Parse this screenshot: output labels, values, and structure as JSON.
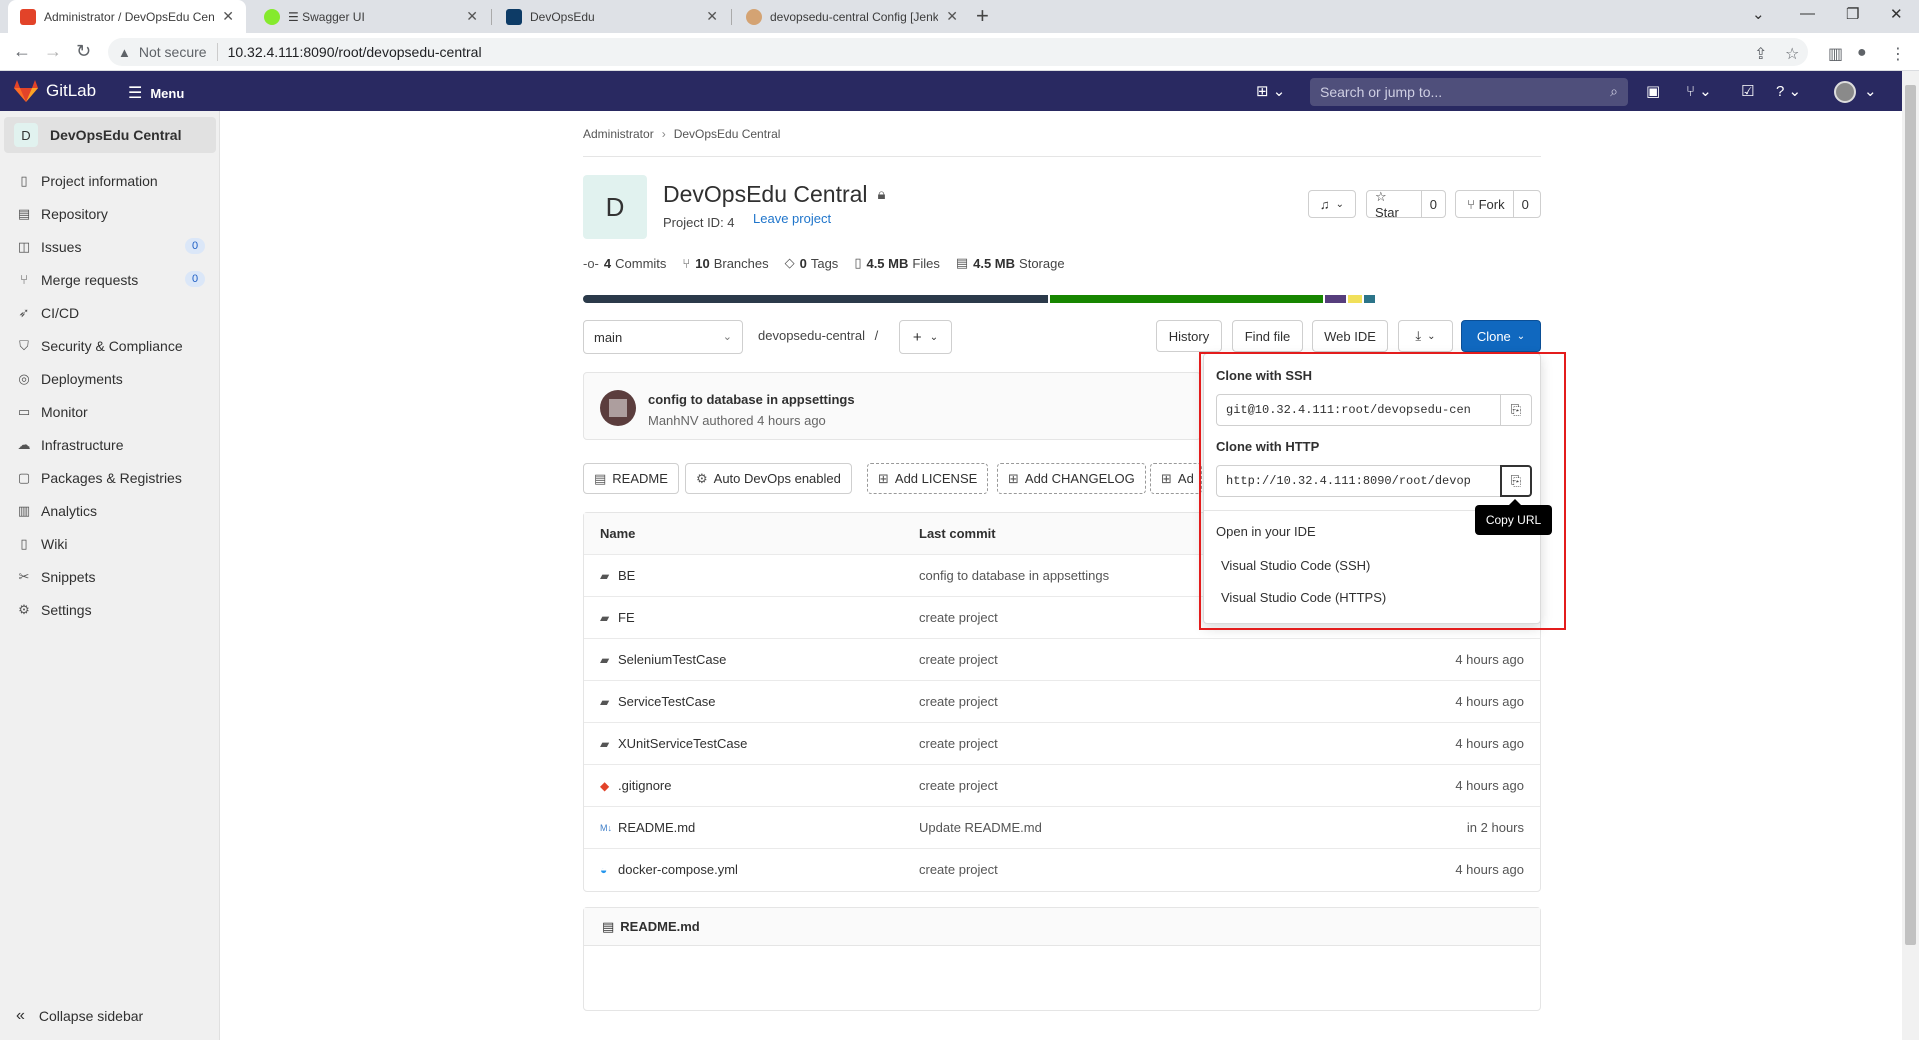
{
  "browser": {
    "tabs": [
      {
        "label": "Administrator / DevOpsEdu Centr",
        "color": "#e24329"
      },
      {
        "label": "Swagger UI",
        "color": "#85ea2d"
      },
      {
        "label": "DevOpsEdu",
        "color": "#0d3b66"
      },
      {
        "label": "devopsedu-central Config [Jenkin",
        "color": "#d4a373"
      }
    ],
    "not_secure": "Not secure",
    "url": "10.32.4.111:8090/root/devopsedu-central"
  },
  "header": {
    "brand": "GitLab",
    "menu_label": "Menu",
    "search_placeholder": "Search or jump to..."
  },
  "sidebar": {
    "project_initial": "D",
    "project_name": "DevOpsEdu Central",
    "items": [
      {
        "label": "Project information",
        "icon": "info-icon"
      },
      {
        "label": "Repository",
        "icon": "repository-icon"
      },
      {
        "label": "Issues",
        "icon": "issues-icon",
        "badge": "0"
      },
      {
        "label": "Merge requests",
        "icon": "merge-request-icon",
        "badge": "0"
      },
      {
        "label": "CI/CD",
        "icon": "rocket-icon"
      },
      {
        "label": "Security & Compliance",
        "icon": "shield-icon"
      },
      {
        "label": "Deployments",
        "icon": "deployments-icon"
      },
      {
        "label": "Monitor",
        "icon": "monitor-icon"
      },
      {
        "label": "Infrastructure",
        "icon": "cloud-icon"
      },
      {
        "label": "Packages & Registries",
        "icon": "package-icon"
      },
      {
        "label": "Analytics",
        "icon": "chart-icon"
      },
      {
        "label": "Wiki",
        "icon": "book-icon"
      },
      {
        "label": "Snippets",
        "icon": "scissors-icon"
      },
      {
        "label": "Settings",
        "icon": "gear-icon"
      }
    ],
    "collapse_label": "Collapse sidebar"
  },
  "breadcrumb": {
    "root": "Administrator",
    "current": "DevOpsEdu Central"
  },
  "project": {
    "initial": "D",
    "title": "DevOpsEdu Central",
    "id_label": "Project ID: 4",
    "leave_label": "Leave project",
    "star_label": "Star",
    "star_count": "0",
    "fork_label": "Fork",
    "fork_count": "0"
  },
  "stats": {
    "commits_num": "4",
    "commits_label": "Commits",
    "branches_num": "10",
    "branches_label": "Branches",
    "tags_num": "0",
    "tags_label": "Tags",
    "files_num": "4.5 MB",
    "files_label": "Files",
    "storage_num": "4.5 MB",
    "storage_label": "Storage"
  },
  "language_bar": [
    {
      "color": "#2b3a4a",
      "share": 0.485
    },
    {
      "color": "#178600",
      "share": 0.285
    },
    {
      "color": "#563d7c",
      "share": 0.022
    },
    {
      "color": "#f1e05a",
      "share": 0.015
    },
    {
      "color": "#2b7489",
      "share": 0.012
    }
  ],
  "toolbar": {
    "branch": "main",
    "path": "devopsedu-central",
    "path_sep": "/",
    "history": "History",
    "find_file": "Find file",
    "web_ide": "Web IDE",
    "clone": "Clone"
  },
  "last_commit": {
    "title": "config to database in appsettings",
    "meta": "ManhNV authored 4 hours ago"
  },
  "pills": [
    {
      "label": "README",
      "icon": "file-icon",
      "dashed": false
    },
    {
      "label": "Auto DevOps enabled",
      "icon": "gear-icon",
      "dashed": false
    },
    {
      "label": "Add LICENSE",
      "icon": "plus-square-icon",
      "dashed": true
    },
    {
      "label": "Add CHANGELOG",
      "icon": "plus-square-icon",
      "dashed": true
    },
    {
      "label": "Ad",
      "icon": "plus-square-icon",
      "dashed": true
    }
  ],
  "files_table": {
    "headers": {
      "name": "Name",
      "last_commit": "Last commit"
    },
    "rows": [
      {
        "name": "BE",
        "type": "folder",
        "commit": "config to database in appsettings",
        "time": ""
      },
      {
        "name": "FE",
        "type": "folder",
        "commit": "create project",
        "time": ""
      },
      {
        "name": "SeleniumTestCase",
        "type": "folder",
        "commit": "create project",
        "time": "4 hours ago"
      },
      {
        "name": "ServiceTestCase",
        "type": "folder",
        "commit": "create project",
        "time": "4 hours ago"
      },
      {
        "name": "XUnitServiceTestCase",
        "type": "folder",
        "commit": "create project",
        "time": "4 hours ago"
      },
      {
        "name": ".gitignore",
        "type": "git",
        "commit": "create project",
        "time": "4 hours ago"
      },
      {
        "name": "README.md",
        "type": "markdown",
        "commit": "Update README.md",
        "time": "in 2 hours"
      },
      {
        "name": "docker-compose.yml",
        "type": "docker",
        "commit": "create project",
        "time": "4 hours ago"
      }
    ]
  },
  "readme": {
    "title": "README.md"
  },
  "clone_dropdown": {
    "ssh_label": "Clone with SSH",
    "ssh_url": "git@10.32.4.111:root/devopsedu-cen",
    "http_label": "Clone with HTTP",
    "http_url": "http://10.32.4.111:8090/root/devop",
    "ide_label": "Open in your IDE",
    "ide_ssh": "Visual Studio Code (SSH)",
    "ide_https": "Visual Studio Code (HTTPS)",
    "tooltip": "Copy URL"
  }
}
